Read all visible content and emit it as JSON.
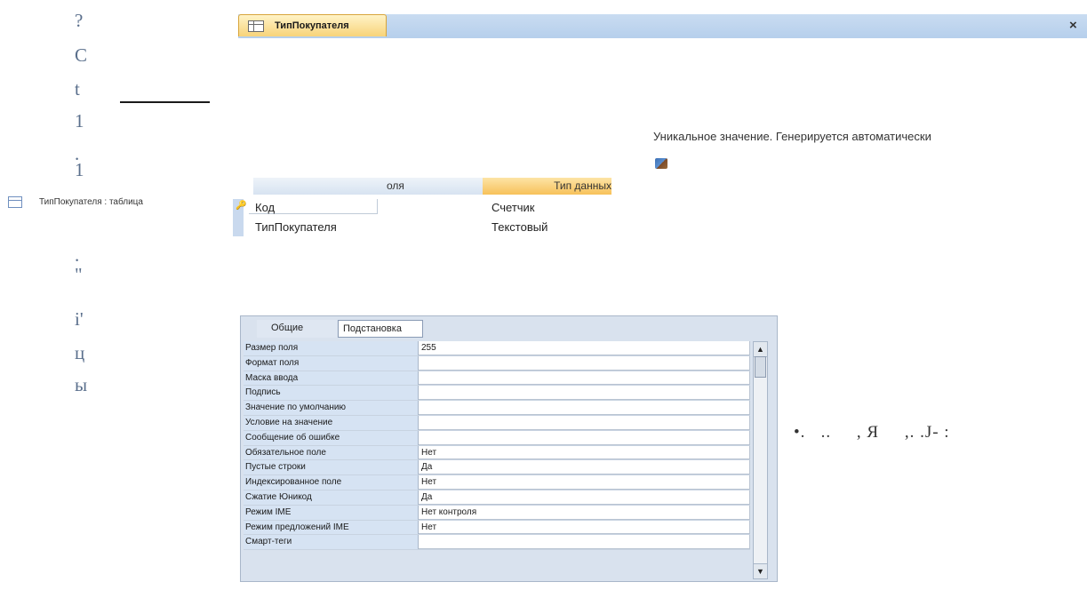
{
  "stray_column": [
    "?",
    "C",
    "t",
    "1",
    ".",
    "1",
    ".",
    "\"",
    "i'",
    "ц",
    "ы"
  ],
  "doc_tab": {
    "label": "ТипПокупателя",
    "close": "×"
  },
  "field_description": "Уникальное значение. Генерируется автоматически",
  "navigation": {
    "object_label": "ТипПокупателя : таблица"
  },
  "design_grid": {
    "header_field": "оля",
    "header_type": "Тип данных",
    "rows": [
      {
        "name": "Код",
        "type": "Счетчик",
        "key": true
      },
      {
        "name": "ТипПокупателя",
        "type": "Текстовый",
        "key": false
      }
    ]
  },
  "properties": {
    "tabs": [
      "Общие",
      "Подстановка"
    ],
    "rows": [
      {
        "label": "Размер поля",
        "value": "255"
      },
      {
        "label": "Формат поля",
        "value": ""
      },
      {
        "label": "Маска ввода",
        "value": ""
      },
      {
        "label": "Подпись",
        "value": ""
      },
      {
        "label": "Значение по умолчанию",
        "value": ""
      },
      {
        "label": "Условие на значение",
        "value": ""
      },
      {
        "label": "Сообщение об ошибке",
        "value": ""
      },
      {
        "label": "Обязательное поле",
        "value": "Нет"
      },
      {
        "label": "Пустые строки",
        "value": "Да"
      },
      {
        "label": "Индексированное поле",
        "value": "Нет"
      },
      {
        "label": "Сжатие Юникод",
        "value": "Да"
      },
      {
        "label": "Режим IME",
        "value": "Нет контроля"
      },
      {
        "label": "Режим предложений IME",
        "value": "Нет"
      },
      {
        "label": "Смарт-теги",
        "value": ""
      }
    ]
  },
  "stray_text": "•.   ..     , Я     ,. .J- :"
}
